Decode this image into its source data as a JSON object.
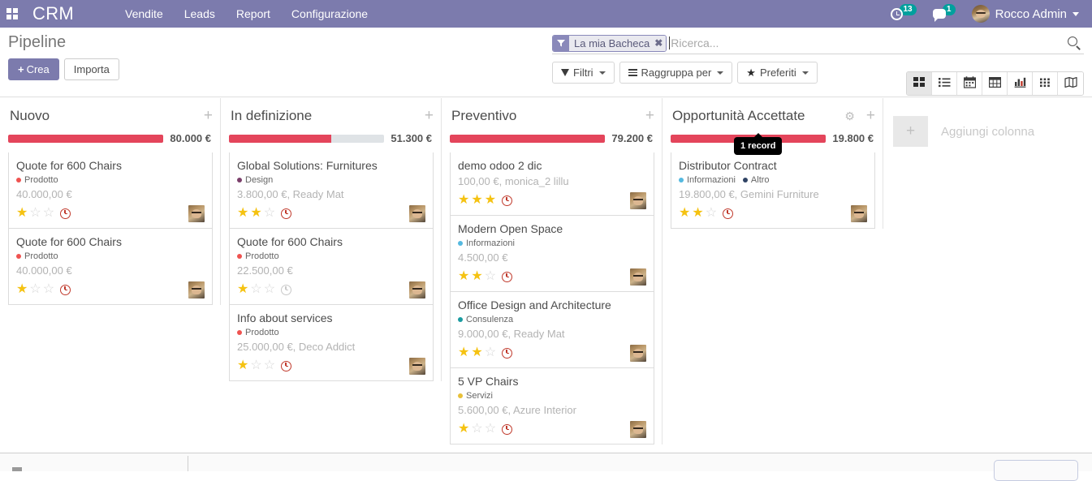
{
  "navbar": {
    "apps_icon": "apps-grid-icon",
    "brand": "CRM",
    "menu": [
      {
        "label": "Vendite"
      },
      {
        "label": "Leads"
      },
      {
        "label": "Report"
      },
      {
        "label": "Configurazione"
      }
    ],
    "activity_count": "13",
    "message_count": "1",
    "user_name": "Rocco Admin",
    "accent_color": "#7c7bad",
    "badge_color": "#00a09d"
  },
  "control_panel": {
    "page_title": "Pipeline",
    "create_label": "Crea",
    "create_plus": "+",
    "import_label": "Importa",
    "search": {
      "facet_label": "La mia Bacheca",
      "facet_remove": "✖",
      "placeholder": "Ricerca...",
      "value": ""
    },
    "filters": [
      {
        "label": "Filtri",
        "icon": "funnel-icon"
      },
      {
        "label": "Raggruppa per",
        "icon": "lines-icon"
      },
      {
        "label": "Preferiti",
        "icon": "star-icon"
      }
    ],
    "views": [
      {
        "name": "kanban",
        "active": true
      },
      {
        "name": "list",
        "active": false
      },
      {
        "name": "calendar",
        "active": false
      },
      {
        "name": "pivot",
        "active": false
      },
      {
        "name": "graph",
        "active": false
      },
      {
        "name": "cohort",
        "active": false
      },
      {
        "name": "map",
        "active": false
      }
    ]
  },
  "kanban": {
    "add_column_label": "Aggiungi colonna",
    "tooltip": {
      "text": "1 record",
      "column": 3
    },
    "columns": [
      {
        "title": "Nuovo",
        "amount": "80.000 €",
        "progress_percent": 100,
        "has_gear": false,
        "cards": [
          {
            "title": "Quote for 600 Chairs",
            "tags": [
              {
                "label": "Prodotto",
                "color": "#ef5350"
              }
            ],
            "subtitle": "40.000,00 €",
            "stars": 1,
            "clock": "red"
          },
          {
            "title": "Quote for 600 Chairs",
            "tags": [
              {
                "label": "Prodotto",
                "color": "#ef5350"
              }
            ],
            "subtitle": "40.000,00 €",
            "stars": 1,
            "clock": "red"
          }
        ]
      },
      {
        "title": "In definizione",
        "amount": "51.300 €",
        "progress_percent": 66,
        "has_gear": false,
        "cards": [
          {
            "title": "Global Solutions: Furnitures",
            "tags": [
              {
                "label": "Design",
                "color": "#7b3f6b"
              }
            ],
            "subtitle": "3.800,00 €, Ready Mat",
            "stars": 2,
            "clock": "red"
          },
          {
            "title": "Quote for 600 Chairs",
            "tags": [
              {
                "label": "Prodotto",
                "color": "#ef5350"
              }
            ],
            "subtitle": "22.500,00 €",
            "stars": 1,
            "clock": "gray"
          },
          {
            "title": "Info about services",
            "tags": [
              {
                "label": "Prodotto",
                "color": "#ef5350"
              }
            ],
            "subtitle": "25.000,00 €, Deco Addict",
            "stars": 1,
            "clock": "red"
          }
        ]
      },
      {
        "title": "Preventivo",
        "amount": "79.200 €",
        "progress_percent": 100,
        "has_gear": false,
        "cards": [
          {
            "title": "demo odoo 2 dic",
            "tags": [],
            "subtitle": "100,00 €, monica_2 lillu",
            "stars": 3,
            "clock": "red"
          },
          {
            "title": "Modern Open Space",
            "tags": [
              {
                "label": "Informazioni",
                "color": "#55b9e0"
              }
            ],
            "subtitle": "4.500,00 €",
            "stars": 2,
            "clock": "red"
          },
          {
            "title": "Office Design and Architecture",
            "tags": [
              {
                "label": "Consulenza",
                "color": "#1a9ba0"
              }
            ],
            "subtitle": "9.000,00 €, Ready Mat",
            "stars": 2,
            "clock": "red"
          },
          {
            "title": "5 VP Chairs",
            "tags": [
              {
                "label": "Servizi",
                "color": "#e8c039"
              }
            ],
            "subtitle": "5.600,00 €, Azure Interior",
            "stars": 1,
            "clock": "red"
          }
        ]
      },
      {
        "title": "Opportunità Accettate",
        "amount": "19.800 €",
        "progress_percent": 100,
        "has_gear": true,
        "cards": [
          {
            "title": "Distributor Contract",
            "tags": [
              {
                "label": "Informazioni",
                "color": "#55b9e0"
              },
              {
                "label": "Altro",
                "color": "#2f4364"
              }
            ],
            "subtitle": "19.800,00 €, Gemini Furniture",
            "stars": 2,
            "clock": "red"
          }
        ]
      }
    ]
  }
}
